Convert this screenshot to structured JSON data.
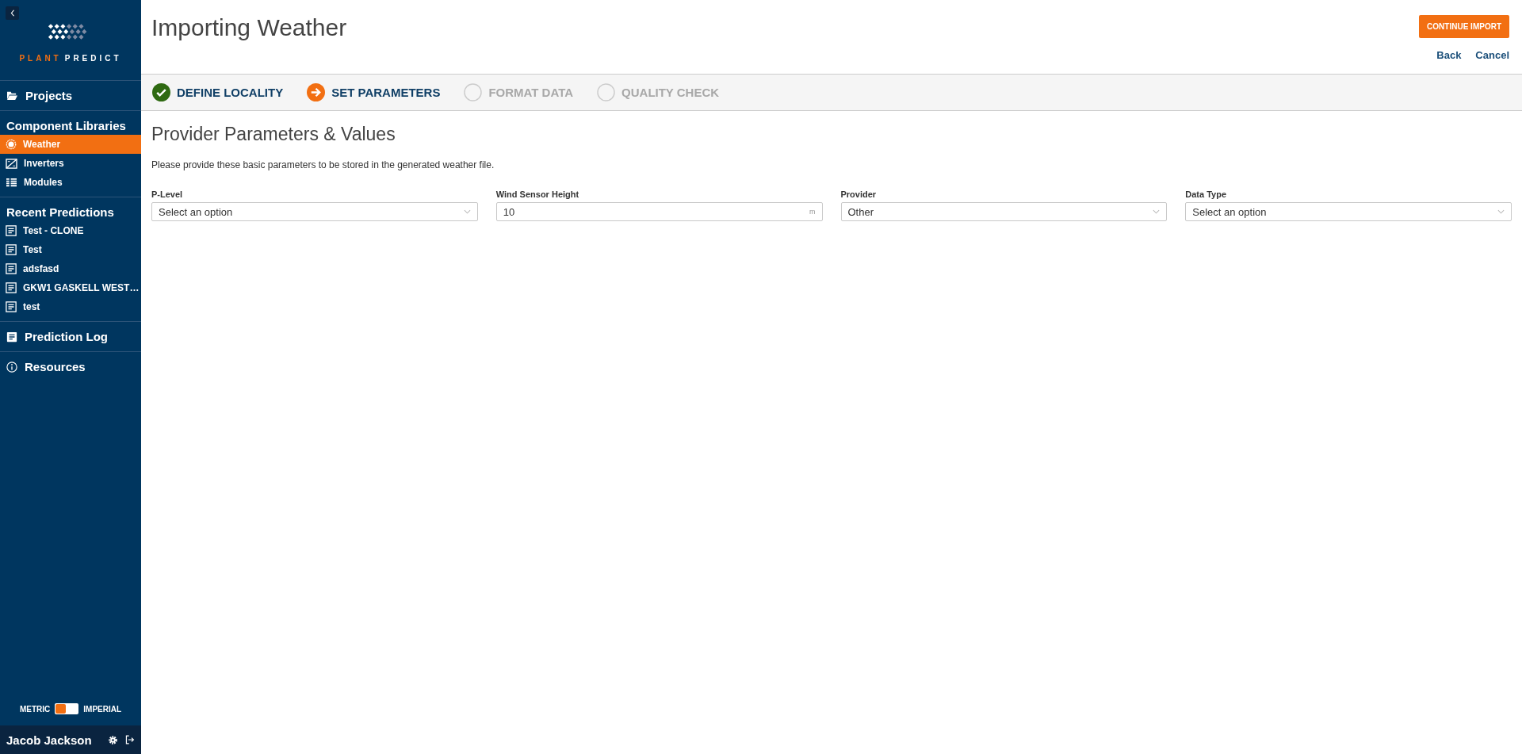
{
  "sidebar": {
    "brand": {
      "left": "PLANT",
      "right": "PREDICT"
    },
    "sections": [
      {
        "kind": "link",
        "label": "Projects"
      },
      {
        "kind": "group",
        "label": "Component Libraries",
        "items": [
          {
            "label": "Weather",
            "selected": true
          },
          {
            "label": "Inverters",
            "selected": false
          },
          {
            "label": "Modules",
            "selected": false
          }
        ]
      },
      {
        "kind": "group",
        "label": "Recent Predictions",
        "items": [
          {
            "label": "Test - CLONE",
            "selected": false
          },
          {
            "label": "Test",
            "selected": false
          },
          {
            "label": "adsfasd",
            "selected": false
          },
          {
            "label": "GKW1 GASKELL WEST…",
            "selected": false
          },
          {
            "label": "test",
            "selected": false
          }
        ]
      },
      {
        "kind": "link",
        "label": "Prediction Log"
      },
      {
        "kind": "link",
        "label": "Resources"
      }
    ],
    "unit_toggle": {
      "left_label": "METRIC",
      "right_label": "IMPERIAL",
      "imperial": false
    },
    "user": {
      "name": "Jacob Jackson"
    }
  },
  "header": {
    "title": "Importing Weather",
    "primary_button": "CONTINUE IMPORT",
    "links": [
      "Back",
      "Cancel"
    ]
  },
  "steps": [
    {
      "label": "DEFINE LOCALITY",
      "completed": true,
      "selected": false
    },
    {
      "label": "SET PARAMETERS",
      "completed": false,
      "selected": true
    },
    {
      "label": "FORMAT DATA",
      "completed": false,
      "selected": false
    },
    {
      "label": "QUALITY CHECK",
      "completed": false,
      "selected": false
    }
  ],
  "section": {
    "title": "Provider Parameters & Values",
    "description": "Please provide these basic parameters to be stored in the generated weather file."
  },
  "fields": [
    {
      "kind": "select",
      "label": "P-Level",
      "placeholder": "Select an option"
    },
    {
      "kind": "input",
      "label": "Wind Sensor Height",
      "value": "10",
      "unit": "m"
    },
    {
      "kind": "select",
      "label": "Provider",
      "value": "Other"
    },
    {
      "kind": "select",
      "label": "Data Type",
      "placeholder": "Select an option"
    }
  ]
}
